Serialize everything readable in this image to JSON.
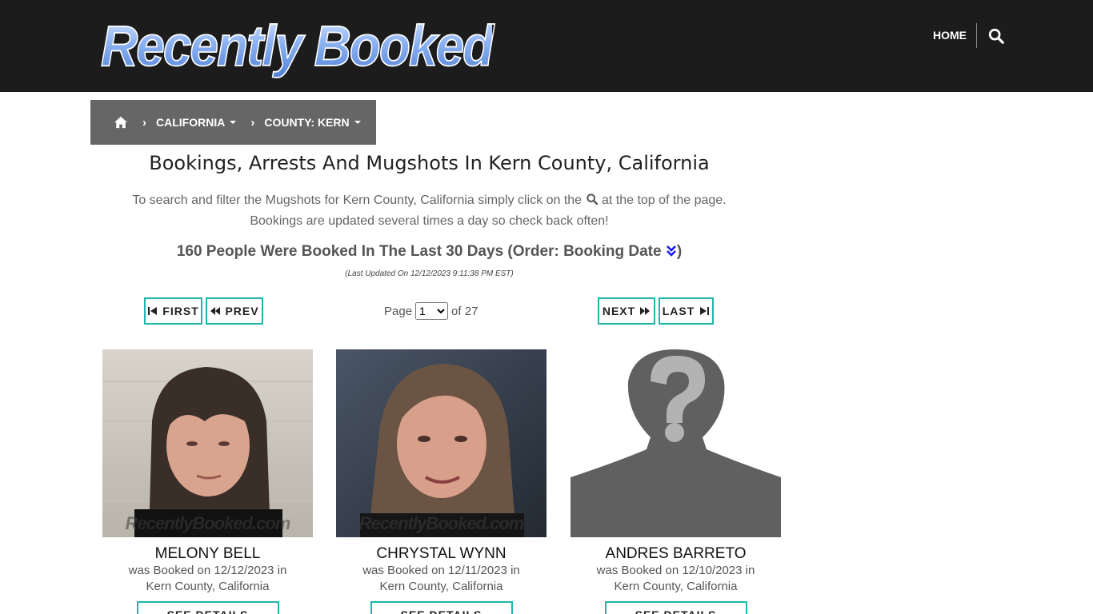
{
  "header": {
    "logo_text": "Recently Booked",
    "nav_home": "HOME",
    "search_icon": "search-icon"
  },
  "breadcrumb": {
    "home_icon": "home-icon",
    "items": [
      {
        "label": "CALIFORNIA"
      },
      {
        "label": "COUNTY: KERN"
      }
    ]
  },
  "main": {
    "title": "Bookings, Arrests And Mugshots In Kern County, California",
    "intro_part1": "To search and filter the Mugshots for Kern County, California simply click on the",
    "intro_part2": "at the top of the page.",
    "intro_line2": "Bookings are updated several times a day so check back often!",
    "count_text": "160 People Were Booked In The Last 30 Days (Order: Booking Date",
    "count_close": ")",
    "updated": "(Last Updated On 12/12/2023 9:11:38 PM EST)"
  },
  "pagination": {
    "first": "FIRST",
    "prev": "PREV",
    "next": "NEXT",
    "last": "LAST",
    "page_label": "Page",
    "current_page": "1",
    "of_label": "of 27"
  },
  "cards": [
    {
      "name": "MELONY BELL",
      "line1": "was Booked on 12/12/2023 in",
      "line2": "Kern County, California",
      "button": "SEE DETAILS",
      "watermark": "RecentlyBooked.com"
    },
    {
      "name": "CHRYSTAL WYNN",
      "line1": "was Booked on 12/11/2023 in",
      "line2": "Kern County, California",
      "button": "SEE DETAILS",
      "watermark": "RecentlyBooked.com"
    },
    {
      "name": "ANDRES BARRETO",
      "line1": "was Booked on 12/10/2023 in",
      "line2": "Kern County, California",
      "button": "SEE DETAILS"
    }
  ],
  "colors": {
    "header_bg": "#1c1c1c",
    "breadcrumb_bg": "#666666",
    "accent": "#1fb5ad"
  }
}
